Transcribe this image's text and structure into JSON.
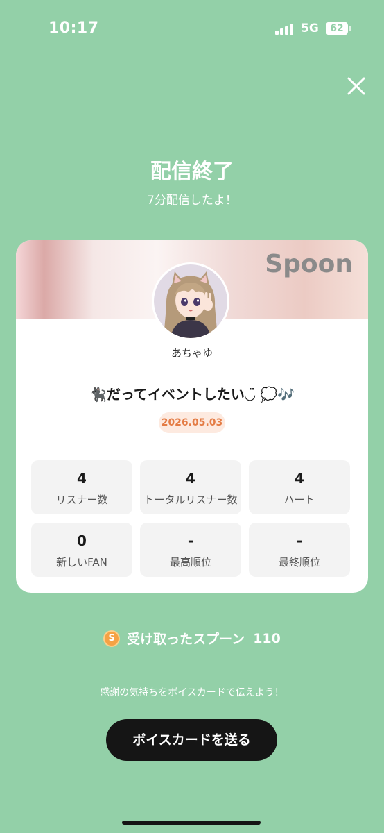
{
  "status_bar": {
    "time": "10:17",
    "network": "5G",
    "battery": "62"
  },
  "header": {
    "title": "配信終了",
    "subtitle": "7分配信したよ！"
  },
  "card": {
    "brand": "Spoon",
    "username": "あちゃゆ",
    "broadcast_title": "🐈‍⬛だってイベントしたい◡̈ 💭🎶",
    "date": "2026.05.03",
    "stats": [
      {
        "value": "4",
        "label": "リスナー数"
      },
      {
        "value": "4",
        "label": "トータルリスナー数"
      },
      {
        "value": "4",
        "label": "ハート"
      },
      {
        "value": "0",
        "label": "新しいFAN"
      },
      {
        "value": "-",
        "label": "最高順位"
      },
      {
        "value": "-",
        "label": "最終順位"
      }
    ]
  },
  "spoons": {
    "icon": "spoon-coin-icon",
    "icon_letter": "S",
    "label": "受け取ったスプーン",
    "count": "110"
  },
  "thanks_message": "感謝の気持ちをボイスカードで伝えよう！",
  "voice_card_button": "ボイスカードを送る",
  "colors": {
    "background": "#93d0a8",
    "button": "#151515",
    "date_text": "#e47c45",
    "date_bg": "#fdeae0",
    "spoon_coin": "#f5a245"
  }
}
